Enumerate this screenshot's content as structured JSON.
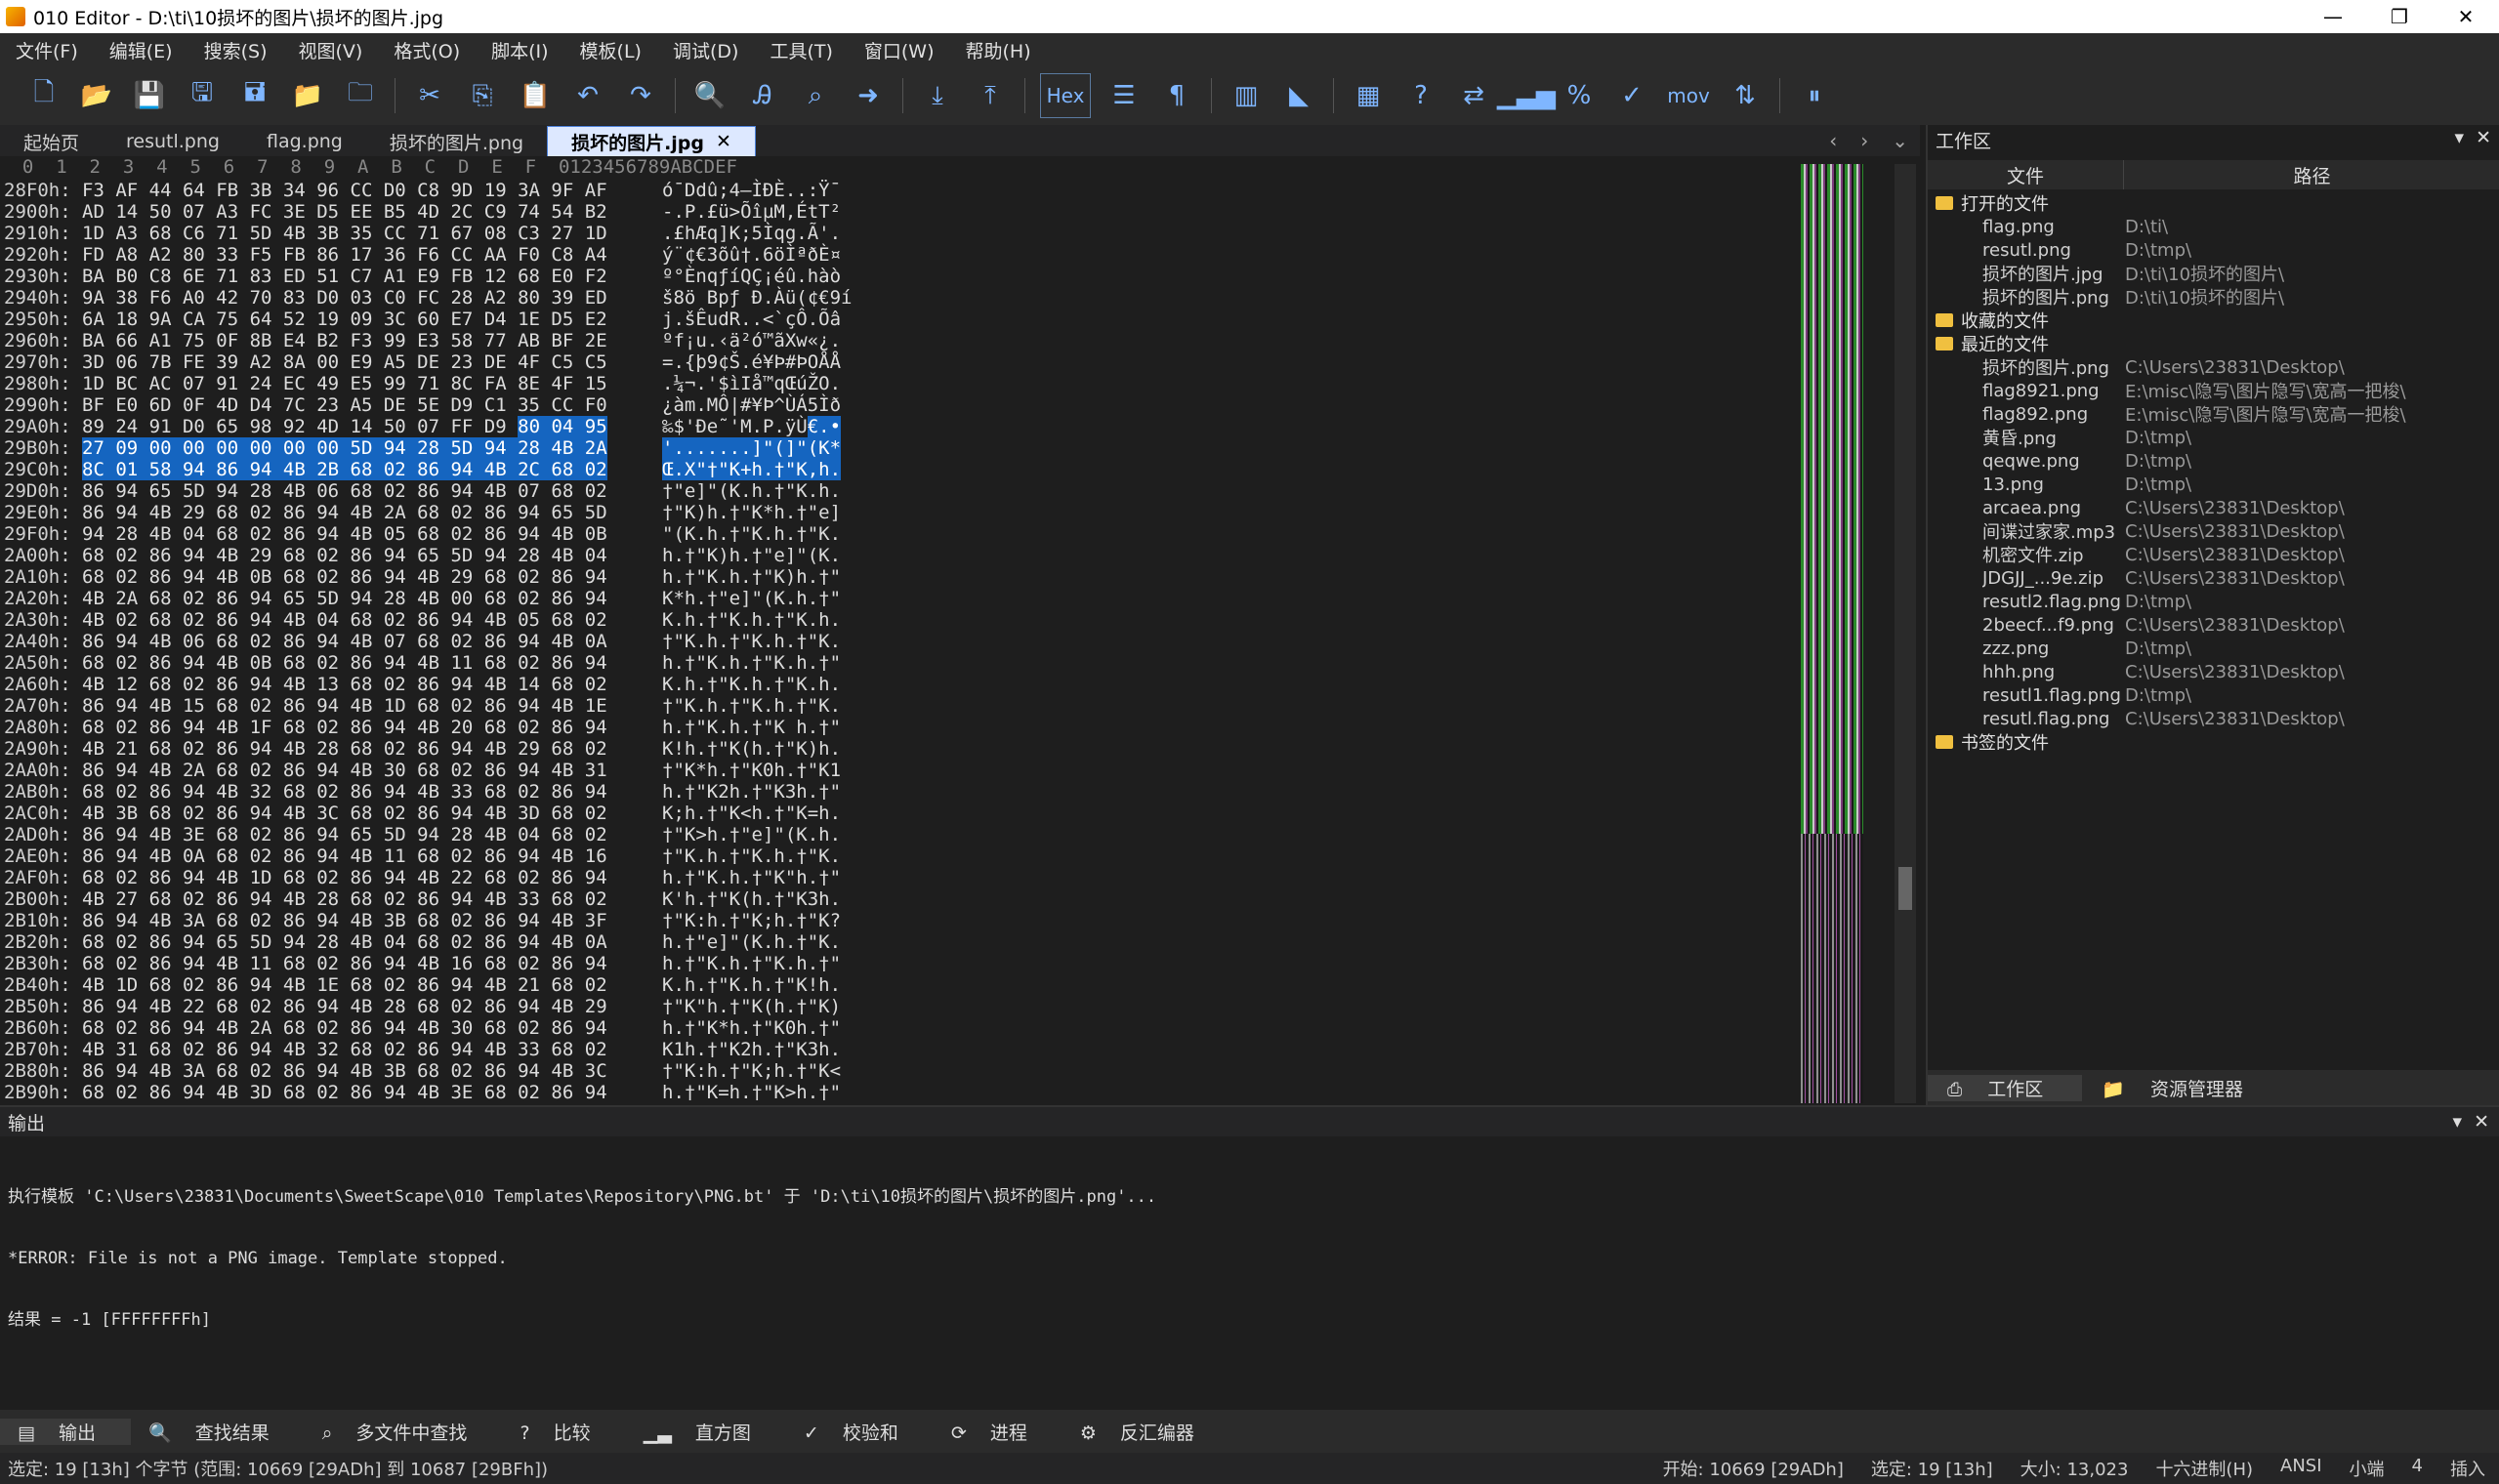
{
  "title": "010 Editor - D:\\ti\\10损坏的图片\\损坏的图片.jpg",
  "window_buttons": [
    "—",
    "❐",
    "✕"
  ],
  "menu": [
    "文件(F)",
    "编辑(E)",
    "搜索(S)",
    "视图(V)",
    "格式(O)",
    "脚本(I)",
    "模板(L)",
    "调试(D)",
    "工具(T)",
    "窗口(W)",
    "帮助(H)"
  ],
  "toolbar": {
    "hex_label": "Hex",
    "mov_label": "mov"
  },
  "tabs": [
    {
      "label": "起始页",
      "active": false
    },
    {
      "label": "resutl.png",
      "active": false
    },
    {
      "label": "flag.png",
      "active": false
    },
    {
      "label": "损坏的图片.png",
      "active": false
    },
    {
      "label": "损坏的图片.jpg",
      "active": true
    }
  ],
  "hex_header": "  0  1  2  3  4  5  6  7  8  9  A  B  C  D  E  F  0123456789ABCDEF",
  "hex_rows": [
    {
      "addr": "28F0h:",
      "bytes": "F3 AF 44 64 FB 3B 34 96 CC D0 C8 9D 19 3A 9F AF",
      "ascii": "ó¯Ddû;4–ÌÐÈ..:Ÿ¯"
    },
    {
      "addr": "2900h:",
      "bytes": "AD 14 50 07 A3 FC 3E D5 EE B5 4D 2C C9 74 54 B2",
      "ascii": "-.P.£ü>ÕîµM,ÉtT²"
    },
    {
      "addr": "2910h:",
      "bytes": "1D A3 68 C6 71 5D 4B 3B 35 CC 71 67 08 C3 27 1D",
      "ascii": ".£hÆq]K;5Ìqg.Ã'."
    },
    {
      "addr": "2920h:",
      "bytes": "FD A8 A2 80 33 F5 FB 86 17 36 F6 CC AA F0 C8 A4",
      "ascii": "ý¨¢€3õû†.6öÌªðÈ¤"
    },
    {
      "addr": "2930h:",
      "bytes": "BA B0 C8 6E 71 83 ED 51 C7 A1 E9 FB 12 68 E0 F2",
      "ascii": "º°ÈnqƒíQÇ¡éû.hàò"
    },
    {
      "addr": "2940h:",
      "bytes": "9A 38 F6 A0 42 70 83 D0 03 C0 FC 28 A2 80 39 ED",
      "ascii": "š8ö Bpƒ Ð.Àü(¢€9í"
    },
    {
      "addr": "2950h:",
      "bytes": "6A 18 9A CA 75 64 52 19 09 3C 60 E7 D4 1E D5 E2",
      "ascii": "j.šÊudR..<`çÔ.Õâ"
    },
    {
      "addr": "2960h:",
      "bytes": "BA 66 A1 75 0F 8B E4 B2 F3 99 E3 58 77 AB BF 2E",
      "ascii": "ºf¡u.‹ä²ó™ãXw«¿."
    },
    {
      "addr": "2970h:",
      "bytes": "3D 06 7B FE 39 A2 8A 00 E9 A5 DE 23 DE 4F C5 C5",
      "ascii": "=.{þ9¢Š.é¥Þ#ÞOÅÅ"
    },
    {
      "addr": "2980h:",
      "bytes": "1D BC AC 07 91 24 EC 49 E5 99 71 8C FA 8E 4F 15",
      "ascii": ".¼¬.'$ìIå™qŒúŽO."
    },
    {
      "addr": "2990h:",
      "bytes": "BF E0 6D 0F 4D D4 7C 23 A5 DE 5E D9 C1 35 CC F0",
      "ascii": "¿àm.MÔ|#¥Þ^ÙÁ5Ìð"
    },
    {
      "addr": "29A0h:",
      "bytes": "89 24 91 D0 65 98 92 4D 14 50 07 FF D9 80 04 95",
      "ascii": "‰$'Ðe˜'M.P.ÿÙ€.•",
      "sel_from": 13
    },
    {
      "addr": "29B0h:",
      "bytes": "27 09 00 00 00 00 00 00 5D 94 28 5D 94 28 4B 2A",
      "ascii": "'.......]\"(]\"(K*",
      "sel_all": true
    },
    {
      "addr": "29C0h:",
      "bytes": "8C 01 58 94 86 94 4B 2B 68 02 86 94 4B 2C 68 02",
      "ascii": "Œ.X\"†\"K+h.†\"K,h.",
      "sel_to": 16
    },
    {
      "addr": "29D0h:",
      "bytes": "86 94 65 5D 94 28 4B 06 68 02 86 94 4B 07 68 02",
      "ascii": "†\"e]\"(K.h.†\"K.h."
    },
    {
      "addr": "29E0h:",
      "bytes": "86 94 4B 29 68 02 86 94 4B 2A 68 02 86 94 65 5D",
      "ascii": "†\"K)h.†\"K*h.†\"e]"
    },
    {
      "addr": "29F0h:",
      "bytes": "94 28 4B 04 68 02 86 94 4B 05 68 02 86 94 4B 0B",
      "ascii": "\"(K.h.†\"K.h.†\"K."
    },
    {
      "addr": "2A00h:",
      "bytes": "68 02 86 94 4B 29 68 02 86 94 65 5D 94 28 4B 04",
      "ascii": "h.†\"K)h.†\"e]\"(K."
    },
    {
      "addr": "2A10h:",
      "bytes": "68 02 86 94 4B 0B 68 02 86 94 4B 29 68 02 86 94",
      "ascii": "h.†\"K.h.†\"K)h.†\""
    },
    {
      "addr": "2A20h:",
      "bytes": "4B 2A 68 02 86 94 65 5D 94 28 4B 00 68 02 86 94",
      "ascii": "K*h.†\"e]\"(K.h.†\""
    },
    {
      "addr": "2A30h:",
      "bytes": "4B 02 68 02 86 94 4B 04 68 02 86 94 4B 05 68 02",
      "ascii": "K.h.†\"K.h.†\"K.h."
    },
    {
      "addr": "2A40h:",
      "bytes": "86 94 4B 06 68 02 86 94 4B 07 68 02 86 94 4B 0A",
      "ascii": "†\"K.h.†\"K.h.†\"K."
    },
    {
      "addr": "2A50h:",
      "bytes": "68 02 86 94 4B 0B 68 02 86 94 4B 11 68 02 86 94",
      "ascii": "h.†\"K.h.†\"K.h.†\""
    },
    {
      "addr": "2A60h:",
      "bytes": "4B 12 68 02 86 94 4B 13 68 02 86 94 4B 14 68 02",
      "ascii": "K.h.†\"K.h.†\"K.h."
    },
    {
      "addr": "2A70h:",
      "bytes": "86 94 4B 15 68 02 86 94 4B 1D 68 02 86 94 4B 1E",
      "ascii": "†\"K.h.†\"K.h.†\"K."
    },
    {
      "addr": "2A80h:",
      "bytes": "68 02 86 94 4B 1F 68 02 86 94 4B 20 68 02 86 94",
      "ascii": "h.†\"K.h.†\"K h.†\""
    },
    {
      "addr": "2A90h:",
      "bytes": "4B 21 68 02 86 94 4B 28 68 02 86 94 4B 29 68 02",
      "ascii": "K!h.†\"K(h.†\"K)h."
    },
    {
      "addr": "2AA0h:",
      "bytes": "86 94 4B 2A 68 02 86 94 4B 30 68 02 86 94 4B 31",
      "ascii": "†\"K*h.†\"K0h.†\"K1"
    },
    {
      "addr": "2AB0h:",
      "bytes": "68 02 86 94 4B 32 68 02 86 94 4B 33 68 02 86 94",
      "ascii": "h.†\"K2h.†\"K3h.†\""
    },
    {
      "addr": "2AC0h:",
      "bytes": "4B 3B 68 02 86 94 4B 3C 68 02 86 94 4B 3D 68 02",
      "ascii": "K;h.†\"K<h.†\"K=h."
    },
    {
      "addr": "2AD0h:",
      "bytes": "86 94 4B 3E 68 02 86 94 65 5D 94 28 4B 04 68 02",
      "ascii": "†\"K>h.†\"e]\"(K.h."
    },
    {
      "addr": "2AE0h:",
      "bytes": "86 94 4B 0A 68 02 86 94 4B 11 68 02 86 94 4B 16",
      "ascii": "†\"K.h.†\"K.h.†\"K."
    },
    {
      "addr": "2AF0h:",
      "bytes": "68 02 86 94 4B 1D 68 02 86 94 4B 22 68 02 86 94",
      "ascii": "h.†\"K.h.†\"K\"h.†\""
    },
    {
      "addr": "2B00h:",
      "bytes": "4B 27 68 02 86 94 4B 28 68 02 86 94 4B 33 68 02",
      "ascii": "K'h.†\"K(h.†\"K3h."
    },
    {
      "addr": "2B10h:",
      "bytes": "86 94 4B 3A 68 02 86 94 4B 3B 68 02 86 94 4B 3F",
      "ascii": "†\"K:h.†\"K;h.†\"K?"
    },
    {
      "addr": "2B20h:",
      "bytes": "68 02 86 94 65 5D 94 28 4B 04 68 02 86 94 4B 0A",
      "ascii": "h.†\"e]\"(K.h.†\"K."
    },
    {
      "addr": "2B30h:",
      "bytes": "68 02 86 94 4B 11 68 02 86 94 4B 16 68 02 86 94",
      "ascii": "h.†\"K.h.†\"K.h.†\""
    },
    {
      "addr": "2B40h:",
      "bytes": "4B 1D 68 02 86 94 4B 1E 68 02 86 94 4B 21 68 02",
      "ascii": "K.h.†\"K.h.†\"K!h."
    },
    {
      "addr": "2B50h:",
      "bytes": "86 94 4B 22 68 02 86 94 4B 28 68 02 86 94 4B 29",
      "ascii": "†\"K\"h.†\"K(h.†\"K)"
    },
    {
      "addr": "2B60h:",
      "bytes": "68 02 86 94 4B 2A 68 02 86 94 4B 30 68 02 86 94",
      "ascii": "h.†\"K*h.†\"K0h.†\""
    },
    {
      "addr": "2B70h:",
      "bytes": "4B 31 68 02 86 94 4B 32 68 02 86 94 4B 33 68 02",
      "ascii": "K1h.†\"K2h.†\"K3h."
    },
    {
      "addr": "2B80h:",
      "bytes": "86 94 4B 3A 68 02 86 94 4B 3B 68 02 86 94 4B 3C",
      "ascii": "†\"K:h.†\"K;h.†\"K<"
    },
    {
      "addr": "2B90h:",
      "bytes": "68 02 86 94 4B 3D 68 02 86 94 4B 3E 68 02 86 94",
      "ascii": "h.†\"K=h.†\"K>h.†\""
    }
  ],
  "workspace": {
    "title": "工作区",
    "col_file": "文件",
    "col_path": "路径",
    "groups": [
      {
        "name": "打开的文件",
        "files": [
          {
            "name": "flag.png",
            "path": "D:\\ti\\"
          },
          {
            "name": "resutl.png",
            "path": "D:\\tmp\\"
          },
          {
            "name": "损坏的图片.jpg",
            "path": "D:\\ti\\10损坏的图片\\"
          },
          {
            "name": "损坏的图片.png",
            "path": "D:\\ti\\10损坏的图片\\"
          }
        ]
      },
      {
        "name": "收藏的文件",
        "files": []
      },
      {
        "name": "最近的文件",
        "files": [
          {
            "name": "损坏的图片.png",
            "path": "C:\\Users\\23831\\Desktop\\"
          },
          {
            "name": "flag8921.png",
            "path": "E:\\misc\\隐写\\图片隐写\\宽高一把梭\\"
          },
          {
            "name": "flag892.png",
            "path": "E:\\misc\\隐写\\图片隐写\\宽高一把梭\\"
          },
          {
            "name": "黄昏.png",
            "path": "D:\\tmp\\"
          },
          {
            "name": "qeqwe.png",
            "path": "D:\\tmp\\"
          },
          {
            "name": "13.png",
            "path": "D:\\tmp\\"
          },
          {
            "name": "arcaea.png",
            "path": "C:\\Users\\23831\\Desktop\\"
          },
          {
            "name": "间谍过家家.mp3",
            "path": "C:\\Users\\23831\\Desktop\\"
          },
          {
            "name": "机密文件.zip",
            "path": "C:\\Users\\23831\\Desktop\\"
          },
          {
            "name": "JDGJJ_...9e.zip",
            "path": "C:\\Users\\23831\\Desktop\\"
          },
          {
            "name": "resutl2.flag.png",
            "path": "D:\\tmp\\"
          },
          {
            "name": "2beecf...f9.png",
            "path": "C:\\Users\\23831\\Desktop\\"
          },
          {
            "name": "zzz.png",
            "path": "D:\\tmp\\"
          },
          {
            "name": "hhh.png",
            "path": "C:\\Users\\23831\\Desktop\\"
          },
          {
            "name": "resutl1.flag.png",
            "path": "D:\\tmp\\"
          },
          {
            "name": "resutl.flag.png",
            "path": "C:\\Users\\23831\\Desktop\\"
          }
        ]
      },
      {
        "name": "书签的文件",
        "files": []
      }
    ],
    "tabs": [
      "工作区",
      "资源管理器"
    ]
  },
  "output": {
    "title": "输出",
    "lines": [
      "执行模板 'C:\\Users\\23831\\Documents\\SweetScape\\010 Templates\\Repository\\PNG.bt' 于 'D:\\ti\\10损坏的图片\\损坏的图片.png'...",
      "*ERROR: File is not a PNG image. Template stopped.",
      "结果 = -1 [FFFFFFFFh]"
    ]
  },
  "bottom_tabs": [
    "输出",
    "查找结果",
    "多文件中查找",
    "比较",
    "直方图",
    "校验和",
    "进程",
    "反汇编器"
  ],
  "status": {
    "left": "选定: 19 [13h] 个字节 (范围: 10669 [29ADh] 到 10687 [29BFh])",
    "start": "开始: 10669 [29ADh]",
    "selected": "选定: 19 [13h]",
    "size": "大小: 13,023",
    "mode": "十六进制(H)",
    "encoding": "ANSI",
    "endian": "小端",
    "col": "4",
    "insert": "插入"
  }
}
